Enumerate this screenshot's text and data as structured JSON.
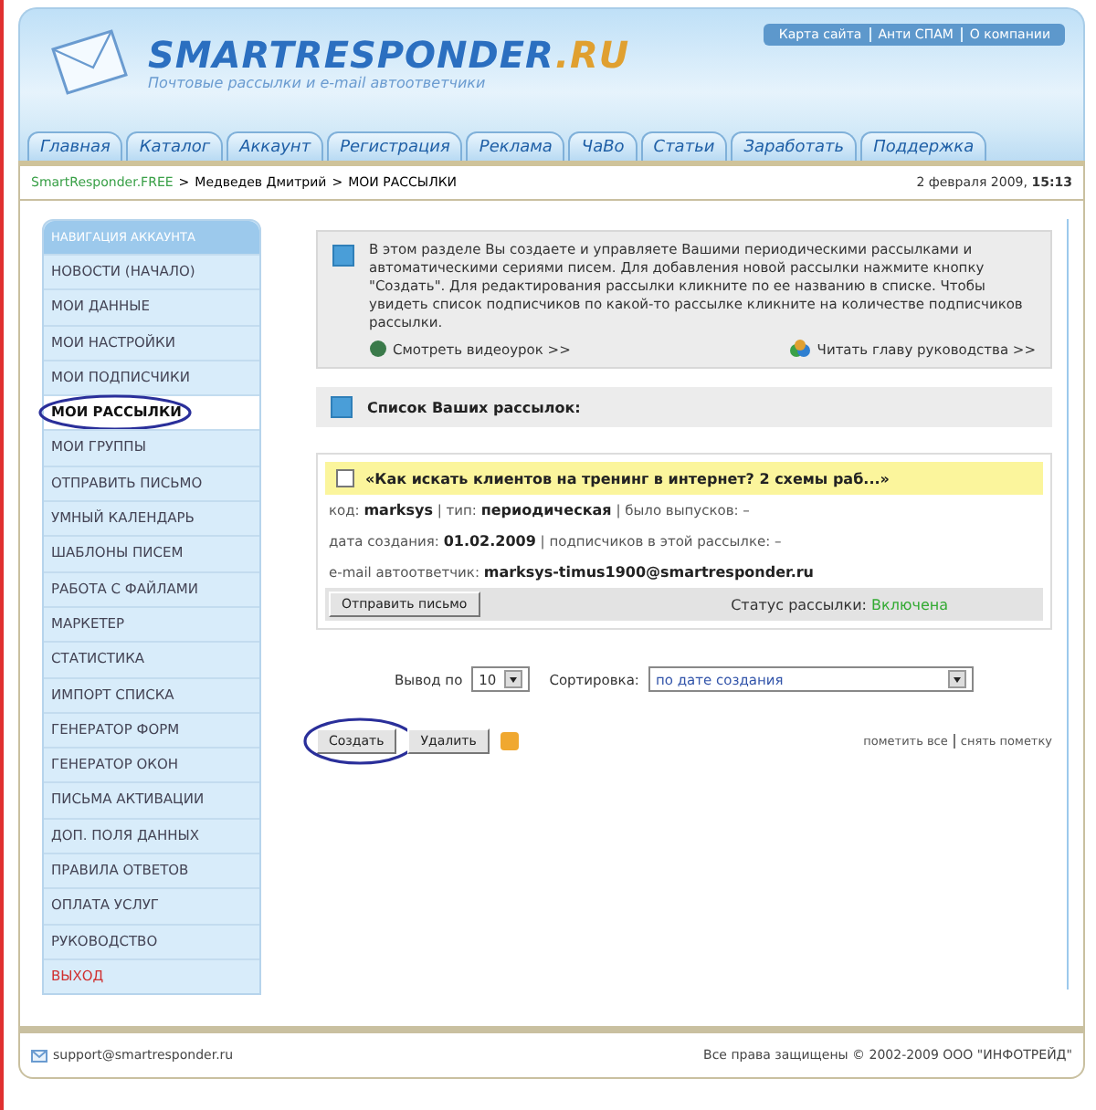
{
  "header": {
    "logo": "SMARTRESPONDER",
    "logo_suffix": ".RU",
    "tagline": "Почтовые рассылки и e-mail автоответчики",
    "top_links": [
      "Карта сайта",
      "Анти СПАМ",
      "О компании"
    ]
  },
  "tabs": [
    {
      "label": "Главная"
    },
    {
      "label": "Каталог"
    },
    {
      "label": "Аккаунт"
    },
    {
      "label": "Регистрация"
    },
    {
      "label": "Реклама"
    },
    {
      "label": "ЧаВо"
    },
    {
      "label": "Статьи"
    },
    {
      "label": "Заработать"
    },
    {
      "label": "Поддержка"
    }
  ],
  "breadcrumb": [
    "SmartResponder.FREE",
    "Медведев Дмитрий",
    "МОИ РАССЫЛКИ"
  ],
  "breadcrumb_separator": ">",
  "datetime": "2 февраля 2009, **15:13**",
  "sidebar": {
    "title": "НАВИГАЦИЯ АККАУНТА",
    "items": [
      {
        "label": "НОВОСТИ (НАЧАЛО)",
        "kind": "link",
        "selected": false,
        "circled": false
      },
      {
        "label": "МОИ ДАННЫЕ",
        "kind": "link",
        "selected": false,
        "circled": false
      },
      {
        "label": "МОИ НАСТРОЙКИ",
        "kind": "link",
        "selected": false,
        "circled": false
      },
      {
        "label": "МОИ ПОДПИСЧИКИ",
        "kind": "link",
        "selected": false,
        "circled": false
      },
      {
        "label": "МОИ РАССЫЛКИ",
        "kind": "link",
        "selected": true,
        "circled": true
      },
      {
        "label": "МОИ ГРУППЫ",
        "kind": "link",
        "selected": false,
        "circled": false
      },
      {
        "label": "ОТПРАВИТЬ ПИСЬМО",
        "kind": "link",
        "selected": false,
        "circled": false
      },
      {
        "label": "УМНЫЙ КАЛЕНДАРЬ",
        "kind": "link",
        "selected": false,
        "circled": false
      },
      {
        "label": "ШАБЛОНЫ ПИСЕМ",
        "kind": "link",
        "selected": false,
        "circled": false
      },
      {
        "label": "РАБОТА С ФАЙЛАМИ",
        "kind": "link",
        "selected": false,
        "circled": false
      },
      {
        "label": "МАРКЕТЕР",
        "kind": "link",
        "selected": false,
        "circled": false
      },
      {
        "label": "СТАТИСТИКА",
        "kind": "link",
        "selected": false,
        "circled": false
      },
      {
        "label": "ИМПОРТ СПИСКА",
        "kind": "link",
        "selected": false,
        "circled": false
      },
      {
        "label": "ГЕНЕРАТОР ФОРМ",
        "kind": "link",
        "selected": false,
        "circled": false
      },
      {
        "label": "ГЕНЕРАТОР ОКОН",
        "kind": "link",
        "selected": false,
        "circled": false
      },
      {
        "label": "ПИСЬМА АКТИВАЦИИ",
        "kind": "link",
        "selected": false,
        "circled": false
      },
      {
        "label": "ДОП. ПОЛЯ ДАННЫХ",
        "kind": "link",
        "selected": false,
        "circled": false
      },
      {
        "label": "ПРАВИЛА ОТВЕТОВ",
        "kind": "link",
        "selected": false,
        "circled": false
      },
      {
        "label": "ОПЛАТА УСЛУГ",
        "kind": "link",
        "selected": false,
        "circled": false
      },
      {
        "label": "РУКОВОДСТВО",
        "kind": "link",
        "selected": false,
        "circled": false
      },
      {
        "label": "ВЫХОД",
        "kind": "exit",
        "selected": false,
        "circled": false
      }
    ]
  },
  "info": {
    "text": "В этом разделе Вы создаете и управляете Вашими периодическими рассылками и автоматическими сериями писем. Для добавления новой рассылки нажмите кнопку \"Создать\". Для редактирования рассылки кликните по ее названию в списке. Чтобы увидеть список подписчиков по какой-то рассылке кликните на количестве подписчиков рассылки.",
    "video_link": "Смотреть видеоурок >>",
    "guide_link": "Читать главу руководства >>"
  },
  "list_title": "Список Ваших рассылок:",
  "mailings": [
    {
      "checked": false,
      "title": "«Как искать клиентов на тренинг в интернет? 2 схемы раб...»",
      "lines": [
        "код: **marksys** | тип: **периодическая** | было выпусков: –",
        "дата создания: **01.02.2009** | подписчиков в этой рассылке: –",
        "e-mail автоответчик: **marksys-timus1900@smartresponder.ru**"
      ],
      "send_button": "Отправить письмо",
      "status_label": "Статус рассылки:",
      "status": "Включена"
    }
  ],
  "controls": {
    "per_page_label": "Вывод по",
    "per_page": "10",
    "sort_label": "Сортировка:",
    "sort": "по дате создания"
  },
  "buttons": [
    {
      "label": "Создать",
      "circled": true
    },
    {
      "label": "Удалить",
      "circled": false
    }
  ],
  "mark_links": [
    "пометить все",
    "снять пометку"
  ],
  "footer": {
    "email": "support@smartresponder.ru",
    "copyright": "Все права защищены © 2002-2009 ООО \"ИНФОТРЕЙД\""
  }
}
